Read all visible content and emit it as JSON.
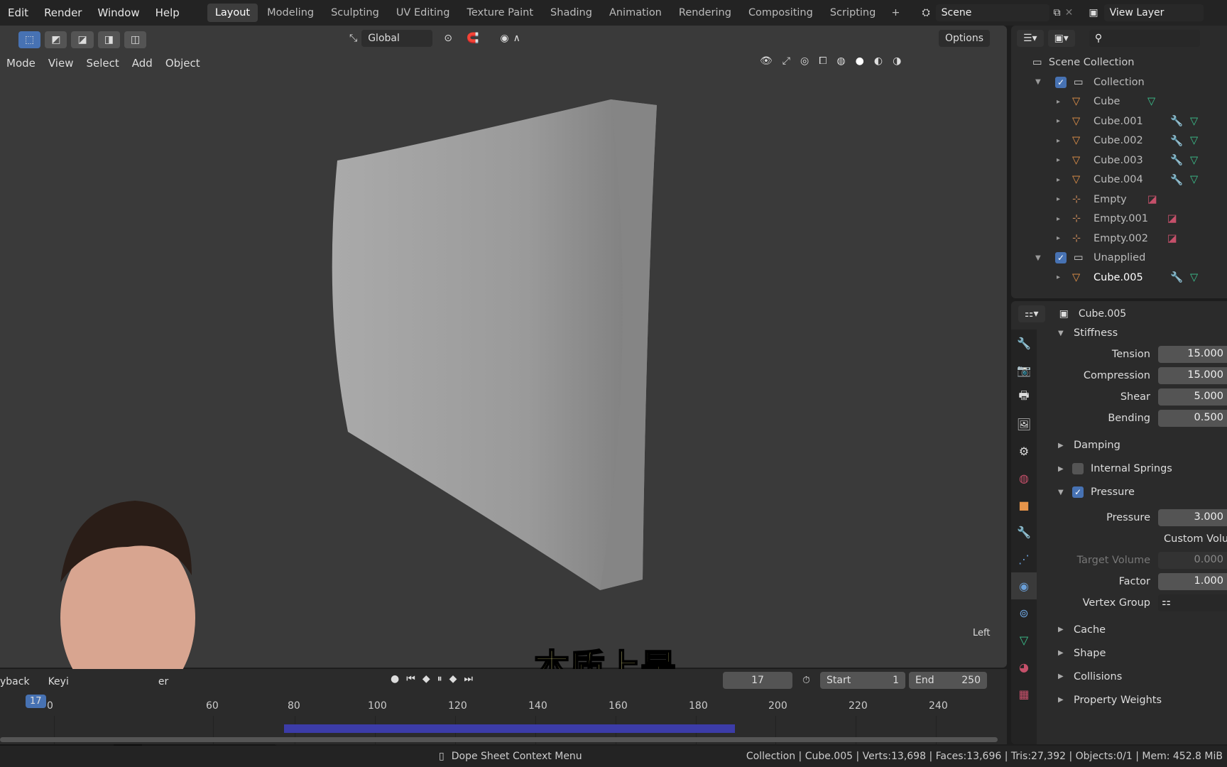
{
  "topbar": {
    "menus": [
      "Edit",
      "Render",
      "Window",
      "Help"
    ],
    "workspaces": [
      "Layout",
      "Modeling",
      "Sculpting",
      "UV Editing",
      "Texture Paint",
      "Shading",
      "Animation",
      "Rendering",
      "Compositing",
      "Scripting"
    ],
    "active_workspace": "Layout",
    "add": "+",
    "scene": "Scene",
    "view_layer": "View Layer"
  },
  "toolheader": {
    "orientation": "Global",
    "options": "Options"
  },
  "viewport": {
    "menus": [
      "Mode",
      "View",
      "Select",
      "Add",
      "Object"
    ],
    "view_name": "Left",
    "subtitle": "本质上是"
  },
  "timeline": {
    "menus": [
      "yback",
      "Keyi",
      "er"
    ],
    "current_frame": "17",
    "start_label": "Start",
    "start": "1",
    "end_label": "End",
    "end": "250",
    "ticks": [
      "0",
      "60",
      "80",
      "100",
      "120",
      "140",
      "160",
      "180",
      "200",
      "220",
      "240"
    ],
    "playhead": "17"
  },
  "outliner": {
    "root": "Scene Collection",
    "items": [
      {
        "name": "Collection",
        "type": "collection",
        "depth": 0
      },
      {
        "name": "Cube",
        "type": "mesh",
        "depth": 1
      },
      {
        "name": "Cube.001",
        "type": "mesh",
        "depth": 1,
        "modifier": true
      },
      {
        "name": "Cube.002",
        "type": "mesh",
        "depth": 1,
        "modifier": true
      },
      {
        "name": "Cube.003",
        "type": "mesh",
        "depth": 1,
        "modifier": true
      },
      {
        "name": "Cube.004",
        "type": "mesh",
        "depth": 1,
        "modifier": true
      },
      {
        "name": "Empty",
        "type": "empty",
        "depth": 1
      },
      {
        "name": "Empty.001",
        "type": "empty",
        "depth": 1
      },
      {
        "name": "Empty.002",
        "type": "empty",
        "depth": 1
      },
      {
        "name": "Unapplied",
        "type": "collection",
        "depth": 0
      },
      {
        "name": "Cube.005",
        "type": "mesh",
        "depth": 1,
        "modifier": true,
        "active": true
      }
    ]
  },
  "properties": {
    "object": "Cube.005",
    "stiffness": {
      "title": "Stiffness",
      "fields": [
        {
          "label": "Tension",
          "value": "15.000"
        },
        {
          "label": "Compression",
          "value": "15.000"
        },
        {
          "label": "Shear",
          "value": "5.000"
        },
        {
          "label": "Bending",
          "value": "0.500"
        }
      ]
    },
    "damping": "Damping",
    "internal_springs": "Internal Springs",
    "pressure": {
      "title": "Pressure",
      "pressure_label": "Pressure",
      "pressure_value": "3.000",
      "custom_volume": "Custom Volu",
      "target_label": "Target Volume",
      "target_value": "0.000",
      "factor_label": "Factor",
      "factor_value": "1.000",
      "vgroup_label": "Vertex Group"
    },
    "sections": [
      "Cache",
      "Shape",
      "Collisions",
      "Property Weights"
    ]
  },
  "status": {
    "context": "Dope Sheet Context Menu",
    "stats": "Collection | Cube.005 | Verts:13,698 | Faces:13,696 | Tris:27,392 | Objects:0/1 | Mem: 452.8 MiB"
  },
  "colors": {
    "accent": "#4772b3",
    "mesh_icon": "#e8954a",
    "subtitle": "#f7f08c"
  }
}
